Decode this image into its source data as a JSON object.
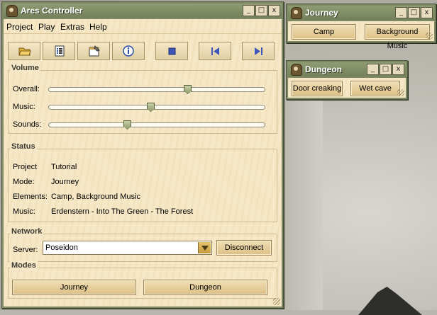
{
  "main_window": {
    "title": "Ares Controller",
    "controls": {
      "minimize": "_",
      "maximize": "□",
      "close": "x"
    },
    "menu": [
      "Project",
      "Play",
      "Extras",
      "Help"
    ],
    "toolbar": [
      {
        "icon": "open-folder-icon"
      },
      {
        "icon": "list-icon"
      },
      {
        "icon": "settings-document-icon"
      },
      {
        "icon": "info-icon"
      },
      {
        "icon": "stop-icon"
      },
      {
        "icon": "skip-back-icon"
      },
      {
        "icon": "skip-forward-icon"
      }
    ],
    "volume": {
      "title": "Volume",
      "sliders": [
        {
          "label": "Overall:",
          "value": 0.65
        },
        {
          "label": "Music:",
          "value": 0.47
        },
        {
          "label": "Sounds:",
          "value": 0.36
        }
      ]
    },
    "status": {
      "title": "Status",
      "rows": [
        {
          "key": "Project",
          "value": "Tutorial"
        },
        {
          "key": "Mode:",
          "value": "Journey"
        },
        {
          "key": "Elements:",
          "value": "Camp, Background Music"
        },
        {
          "key": "Music:",
          "value": "Erdenstern - Into The Green - The Forest"
        }
      ]
    },
    "network": {
      "title": "Network",
      "server_label": "Server:",
      "server_value": "Poseidon",
      "disconnect_label": "Disconnect"
    },
    "modes": {
      "title": "Modes",
      "buttons": [
        "Journey",
        "Dungeon"
      ]
    }
  },
  "journey_window": {
    "title": "Journey",
    "buttons": [
      "Camp",
      "Background Music"
    ]
  },
  "dungeon_window": {
    "title": "Dungeon",
    "buttons": [
      "Door creaking",
      "Wet cave"
    ]
  },
  "colors": {
    "titlebar": "#7f8a64",
    "panel": "#f6e7c6",
    "button": "#dcbf84",
    "accent_arrow": "#c79b39"
  }
}
